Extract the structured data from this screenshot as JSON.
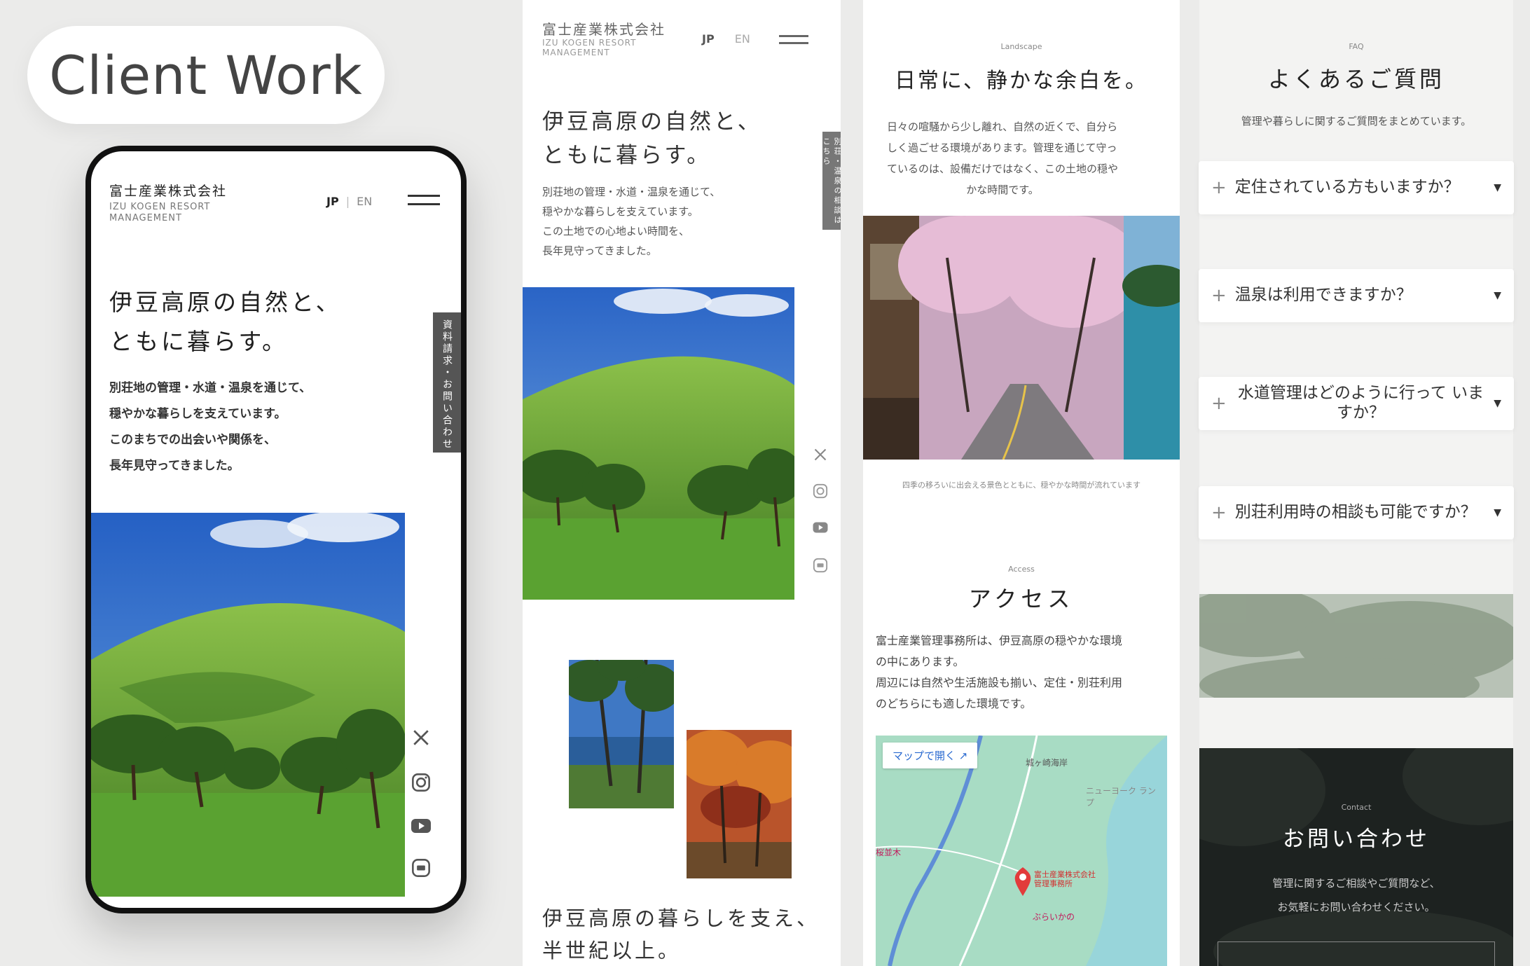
{
  "badge": {
    "label": "Client Work"
  },
  "site": {
    "company": "富士産業株式会社",
    "company_en": "IZU KOGEN RESORT MANAGEMENT",
    "lang_jp": "JP",
    "lang_en": "EN",
    "hero_title_1": "伊豆高原の自然と、",
    "hero_title_2": "ともに暮らす。",
    "hero_lines": [
      "別荘地の管理・水道・温泉を通じて、",
      "穏やかな暮らしを支えています。",
      "このまちでの出会いや関係を、",
      "長年見守ってきました。"
    ],
    "hero_lines_alt": [
      "別荘地の管理・水道・温泉を通じて、",
      "穏やかな暮らしを支えています。",
      "この土地での心地よい時間を、",
      "長年見守ってきました。"
    ],
    "side_tab": "資料請求・お問い合わせ",
    "side_tab_alt": "別荘・温泉の相談はこちら",
    "section_title_1": "伊豆高原の暮らしを支え、",
    "section_title_2": "半世紀以上。"
  },
  "landscape": {
    "eyebrow": "Landscape",
    "title": "日常に、静かな余白を。",
    "lines": [
      "日々の喧騒から少し離れ、自然の近くで、自分ら",
      "しく過ごせる環境があります。管理を通じて守っ",
      "ているのは、設備だけではなく、この土地の穏や",
      "かな時間です。"
    ],
    "caption": "四季の移ろいに出会える景色とともに、穏やかな時間が流れています"
  },
  "access": {
    "eyebrow": "Access",
    "title": "アクセス",
    "lines": [
      "富士産業管理事務所は、伊豆高原の穏やかな環境",
      "の中にあります。",
      "周辺には自然や生活施設も揃い、定住・別荘利用",
      "のどちらにも適した環境です。"
    ],
    "map_button": "マップで開く",
    "map_pin": "富士産業株式会社 管理事務所",
    "map_labels": [
      "城ヶ崎海岸",
      "ニューヨーク ランプ",
      "桜並木",
      "ぶらいかの"
    ]
  },
  "faq": {
    "eyebrow": "FAQ",
    "title": "よくあるご質問",
    "subtitle": "管理や暮らしに関するご質問をまとめています。",
    "items": [
      {
        "q": "定住されている方もいますか？"
      },
      {
        "q": "温泉は利用できますか？"
      },
      {
        "q": "水道管理はどのように行って いますか？"
      },
      {
        "q": "別荘利用時の相談も可能ですか？"
      }
    ]
  },
  "contact": {
    "eyebrow": "Contact",
    "title": "お問い合わせ",
    "lines": [
      "管理に関するご相談やご質問など、",
      "お気軽にお問い合わせください。"
    ]
  },
  "icons": [
    "x-icon",
    "instagram-icon",
    "youtube-icon",
    "line-icon"
  ],
  "colors": {
    "accent": "#555555",
    "dark_panel": "#1d2220",
    "grass": "#5a9a2e",
    "sky": "#2f6fc6"
  }
}
